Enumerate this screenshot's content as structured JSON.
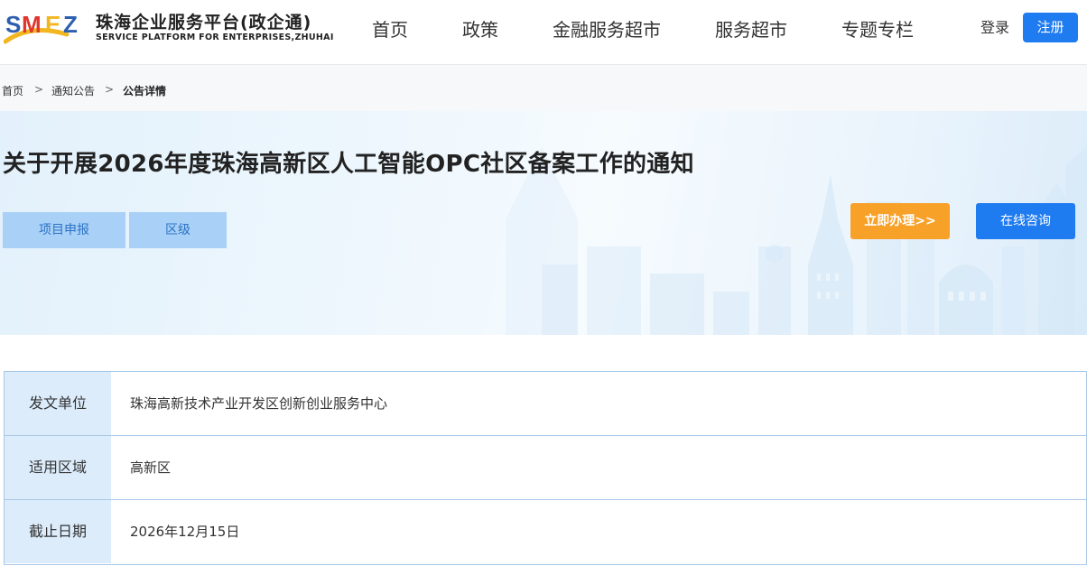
{
  "header": {
    "logo_mark": "SMEZ",
    "logo_cn": "珠海企业服务平台(政企通)",
    "logo_en": "SERVICE PLATFORM FOR ENTERPRISES,ZHUHAI",
    "nav": [
      "首页",
      "政策",
      "金融服务超市",
      "服务超市",
      "专题专栏"
    ],
    "login": "登录",
    "register": "注册"
  },
  "breadcrumb": {
    "items": [
      "首页",
      "通知公告",
      "公告详情"
    ],
    "separator": ">"
  },
  "banner": {
    "title": "关于开展2026年度珠海高新区人工智能OPC社区备案工作的通知",
    "tags": [
      "项目申报",
      "区级"
    ],
    "apply_button": "立即办理>>",
    "consult_button": "在线咨询"
  },
  "info": {
    "rows": [
      {
        "label": "发文单位",
        "value": "珠海高新技术产业开发区创新创业服务中心"
      },
      {
        "label": "适用区域",
        "value": "高新区"
      },
      {
        "label": "截止日期",
        "value": "2026年12月15日"
      }
    ]
  },
  "colors": {
    "primary_blue": "#1f7bf0",
    "apply_orange": "#f8a129",
    "tag_blue": "#a9d0f6",
    "label_bg": "#dcecfb"
  }
}
